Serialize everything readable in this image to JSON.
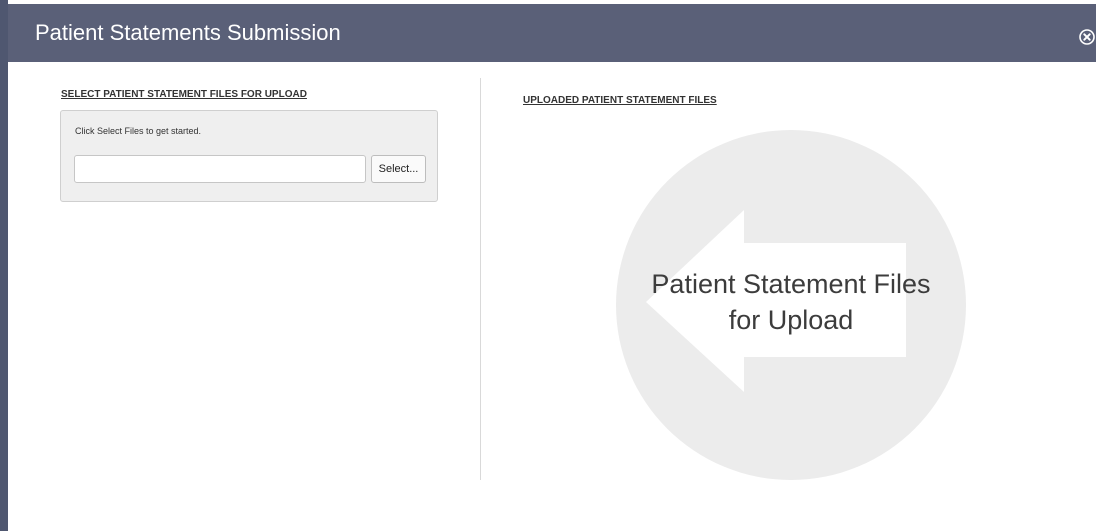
{
  "dialog": {
    "title": "Patient Statements Submission",
    "close_icon": "close-circle-icon"
  },
  "left_panel": {
    "heading": "SELECT PATIENT STATEMENT FILES FOR UPLOAD",
    "hint": "Click Select Files to get started.",
    "file_input_value": "",
    "select_button_label": "Select..."
  },
  "right_panel": {
    "heading": "UPLOADED PATIENT STATEMENT FILES",
    "placeholder_line1": "Patient Statement Files",
    "placeholder_line2": "for Upload",
    "placeholder_icon": "left-arrow-circle-icon"
  },
  "colors": {
    "titlebar": "#5a6078",
    "placeholder_circle": "#ececec"
  }
}
